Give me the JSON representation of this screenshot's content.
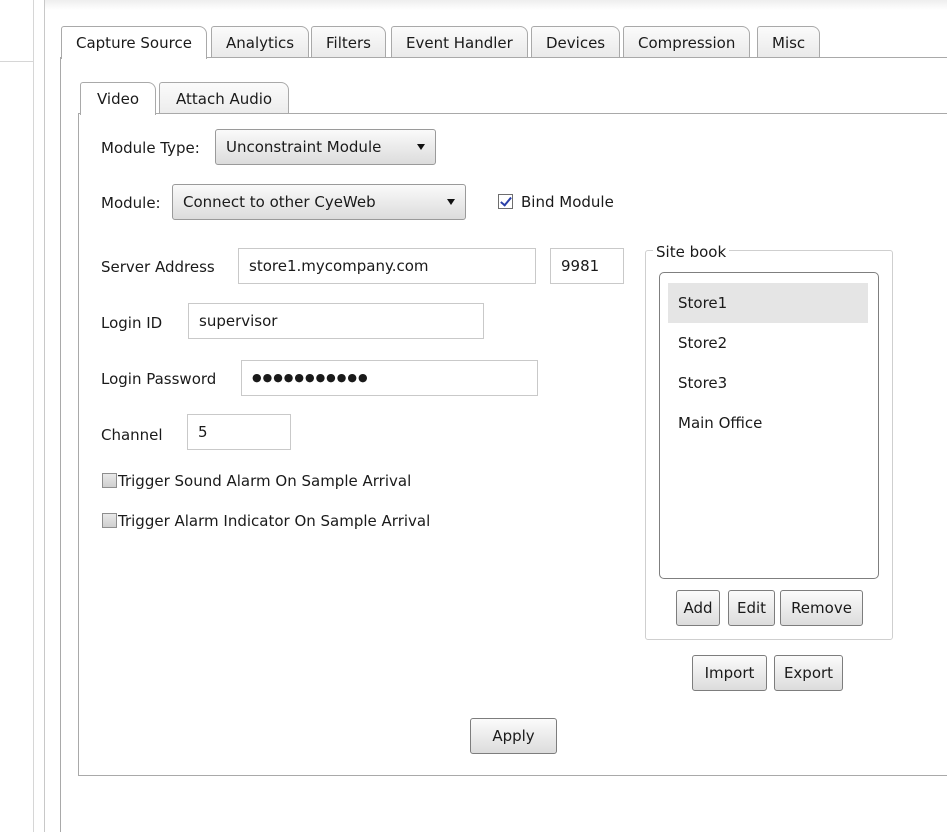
{
  "main_tabs": [
    {
      "label": "Capture Source"
    },
    {
      "label": "Analytics"
    },
    {
      "label": "Filters"
    },
    {
      "label": "Event Handler"
    },
    {
      "label": "Devices"
    },
    {
      "label": "Compression"
    },
    {
      "label": "Misc"
    }
  ],
  "sub_tabs": [
    {
      "label": "Video"
    },
    {
      "label": "Attach Audio"
    }
  ],
  "form": {
    "module_type_label": "Module Type:",
    "module_type_value": "Unconstraint Module",
    "module_label": "Module:",
    "module_value": "Connect to other CyeWeb",
    "bind_module_label": "Bind Module",
    "bind_module_checked": true,
    "server_address_label": "Server Address",
    "server_address_value": "store1.mycompany.com",
    "port_value": "9981",
    "login_id_label": "Login ID",
    "login_id_value": "supervisor",
    "login_password_label": "Login Password",
    "login_password_value": "●●●●●●●●●●●",
    "channel_label": "Channel",
    "channel_value": "5",
    "trigger_sound_label": "Trigger Sound Alarm On Sample Arrival",
    "trigger_indicator_label": "Trigger Alarm Indicator On Sample Arrival"
  },
  "site_book": {
    "title": "Site book",
    "items": [
      {
        "label": "Store1"
      },
      {
        "label": "Store2"
      },
      {
        "label": "Store3"
      },
      {
        "label": "Main Office"
      }
    ],
    "add_label": "Add",
    "edit_label": "Edit",
    "remove_label": "Remove",
    "import_label": "Import",
    "export_label": "Export"
  },
  "apply_label": "Apply"
}
